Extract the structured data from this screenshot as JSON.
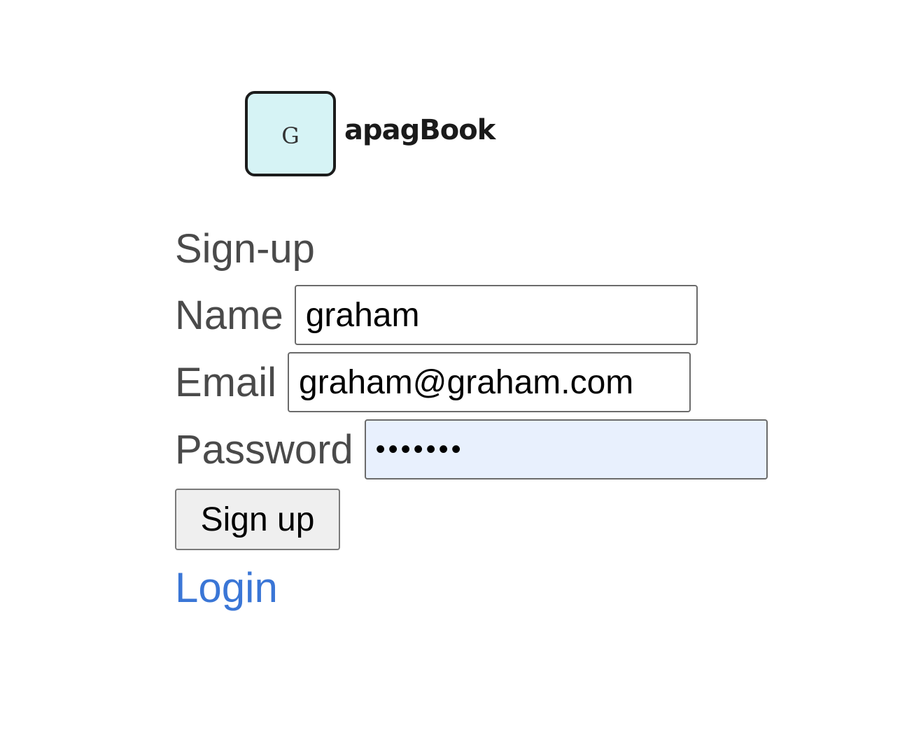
{
  "logo": {
    "badge_letter": "G",
    "wordmark": "apagBook",
    "badge_color": "#d6f3f5"
  },
  "form": {
    "heading": "Sign-up",
    "name": {
      "label": "Name",
      "value": "graham"
    },
    "email": {
      "label": "Email",
      "value": "graham@graham.com"
    },
    "password": {
      "label": "Password",
      "value": "•••••••"
    },
    "submit_label": "Sign up",
    "login_link": "Login"
  },
  "colors": {
    "link": "#3a76d6",
    "label_text": "#4a4a4a",
    "autofill_bg": "#e8f0fd"
  }
}
